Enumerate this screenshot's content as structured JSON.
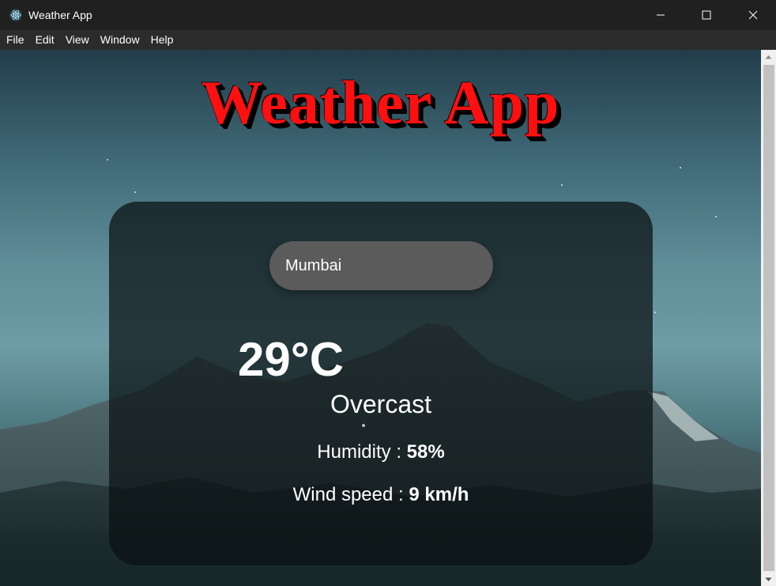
{
  "window": {
    "title": "Weather App",
    "icon": "electron-atom-icon"
  },
  "menu": {
    "items": [
      "File",
      "Edit",
      "View",
      "Window",
      "Help"
    ]
  },
  "app": {
    "heading": "Weather App",
    "search": {
      "value": "Mumbai",
      "placeholder": ""
    },
    "temperature": "29°C",
    "condition": "Overcast",
    "humidity": {
      "label": "Humidity :",
      "value": "58%"
    },
    "wind": {
      "label": "Wind speed :",
      "value": "9 km/h"
    }
  },
  "colors": {
    "heading": "#ff1010",
    "card": "rgba(10,16,18,0.72)",
    "search_bg": "#5b5b5b"
  }
}
